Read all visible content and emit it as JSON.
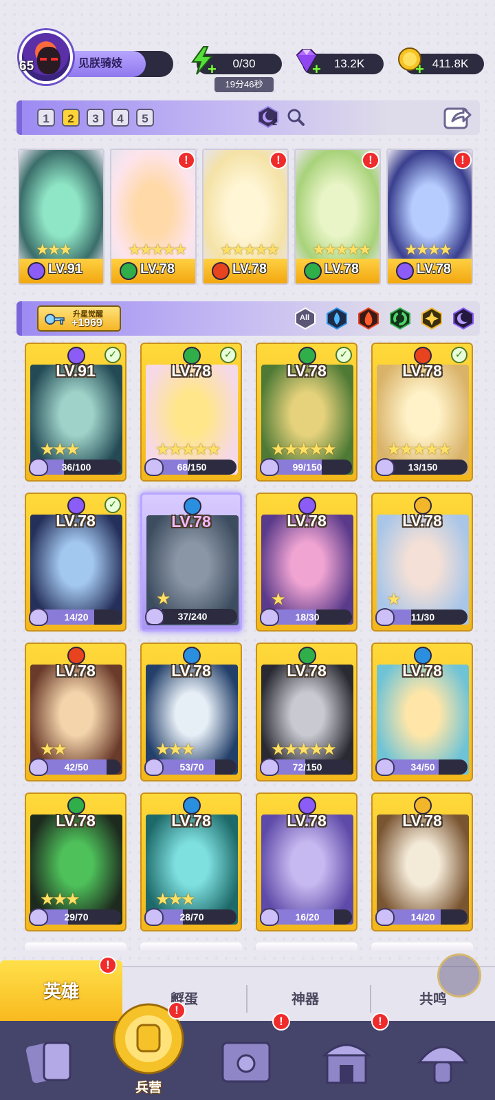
{
  "player": {
    "level": "65",
    "name": "见朕骑妓"
  },
  "resources": {
    "energy": "0/30",
    "energy_timer": "19分46秒",
    "gems": "13.2K",
    "gold": "411.8K"
  },
  "team_tabs": [
    "1",
    "2",
    "3",
    "4",
    "5"
  ],
  "team_selected": "2",
  "team_badge": "2",
  "lineup": [
    {
      "level": "LV.91",
      "element": "dark",
      "stars": "★★★",
      "alert": false
    },
    {
      "level": "LV.78",
      "element": "wind",
      "stars": "★★★★★",
      "alert": true
    },
    {
      "level": "LV.78",
      "element": "fire",
      "stars": "★★★★★",
      "alert": true
    },
    {
      "level": "LV.78",
      "element": "wind",
      "stars": "★★★★★",
      "alert": true
    },
    {
      "level": "LV.78",
      "element": "dark",
      "stars": "★★★★",
      "alert": true
    }
  ],
  "awaken": {
    "label": "升星觉醒",
    "value": "+1969"
  },
  "filters": {
    "all_label": "All"
  },
  "heroes": [
    {
      "level": "LV.91",
      "element": "dark",
      "shards": "36/100",
      "progress": 0.36,
      "stars": "★★★",
      "check": true,
      "selected": false,
      "colors": [
        "#234a55",
        "#9fd3c9"
      ]
    },
    {
      "level": "LV.78",
      "element": "wind",
      "shards": "68/150",
      "progress": 0.45,
      "stars": "★★★★★",
      "check": true,
      "selected": false,
      "colors": [
        "#f6d9e7",
        "#ffe68a"
      ]
    },
    {
      "level": "LV.78",
      "element": "wind",
      "shards": "99/150",
      "progress": 0.66,
      "stars": "★★★★★",
      "check": true,
      "selected": false,
      "colors": [
        "#4e7a35",
        "#e6d27c"
      ]
    },
    {
      "level": "LV.78",
      "element": "fire",
      "shards": "13/150",
      "progress": 0.09,
      "stars": "★★★★★",
      "check": true,
      "selected": false,
      "colors": [
        "#d9b36a",
        "#fff2c8"
      ]
    },
    {
      "level": "LV.78",
      "element": "dark",
      "shards": "14/20",
      "progress": 0.7,
      "stars": "",
      "check": true,
      "selected": false,
      "colors": [
        "#25305a",
        "#a3c8f0"
      ]
    },
    {
      "level": "LV.78",
      "element": "water",
      "shards": "37/240",
      "progress": 0.15,
      "stars": "★",
      "check": false,
      "selected": true,
      "colors": [
        "#3d4d60",
        "#8a96a5"
      ]
    },
    {
      "level": "LV.78",
      "element": "dark",
      "shards": "18/30",
      "progress": 0.6,
      "stars": "★",
      "check": false,
      "selected": false,
      "colors": [
        "#5a3a8a",
        "#f0a4d2"
      ]
    },
    {
      "level": "LV.78",
      "element": "light",
      "shards": "11/30",
      "progress": 0.37,
      "stars": "★",
      "check": false,
      "selected": false,
      "colors": [
        "#a9c6e8",
        "#f4e0d6"
      ]
    },
    {
      "level": "LV.78",
      "element": "fire",
      "shards": "42/50",
      "progress": 0.84,
      "stars": "★★",
      "check": false,
      "selected": false,
      "colors": [
        "#6a3a2a",
        "#f3d4ab"
      ]
    },
    {
      "level": "LV.78",
      "element": "water",
      "shards": "53/70",
      "progress": 0.76,
      "stars": "★★★",
      "check": false,
      "selected": false,
      "colors": [
        "#23406a",
        "#e6eef6"
      ]
    },
    {
      "level": "LV.78",
      "element": "wind",
      "shards": "72/150",
      "progress": 0.48,
      "stars": "★★★★★",
      "check": false,
      "selected": false,
      "colors": [
        "#2a2a32",
        "#c9c9d2"
      ]
    },
    {
      "level": "LV.78",
      "element": "water",
      "shards": "34/50",
      "progress": 0.68,
      "stars": "",
      "check": false,
      "selected": false,
      "colors": [
        "#6fc3d6",
        "#ffe6a8"
      ]
    },
    {
      "level": "LV.78",
      "element": "wind",
      "shards": "29/70",
      "progress": 0.41,
      "stars": "★★★",
      "check": false,
      "selected": false,
      "colors": [
        "#1d2a1e",
        "#4ec15a"
      ]
    },
    {
      "level": "LV.78",
      "element": "water",
      "shards": "28/70",
      "progress": 0.4,
      "stars": "★★★",
      "check": false,
      "selected": false,
      "colors": [
        "#1e6a6a",
        "#7fe0e0"
      ]
    },
    {
      "level": "LV.78",
      "element": "dark",
      "shards": "16/20",
      "progress": 0.8,
      "stars": "",
      "check": false,
      "selected": false,
      "colors": [
        "#5e4aa8",
        "#c6b8f0"
      ]
    },
    {
      "level": "LV.78",
      "element": "light",
      "shards": "14/20",
      "progress": 0.7,
      "stars": "",
      "check": false,
      "selected": false,
      "colors": [
        "#7a5532",
        "#f4ead8"
      ]
    }
  ],
  "subtabs": [
    "英雄",
    "孵蛋",
    "神器",
    "共鸣"
  ],
  "nav": {
    "active_label": "兵营"
  },
  "element_colors": {
    "dark": "#8b5cf6",
    "wind": "#2fae4a",
    "fire": "#e8431f",
    "water": "#2b8fe0",
    "light": "#f1b62a"
  }
}
